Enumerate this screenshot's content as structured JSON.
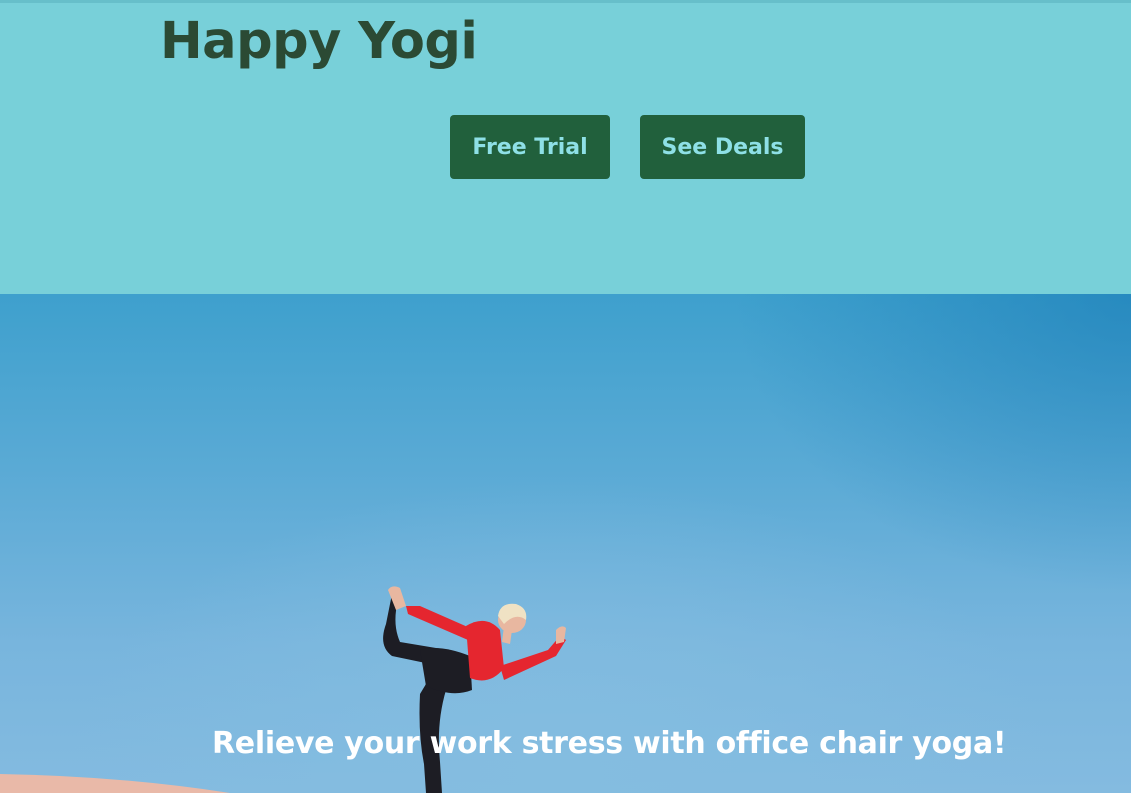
{
  "header": {
    "title": "Happy Yogi",
    "buttons": {
      "free_trial": "Free Trial",
      "see_deals": "See Deals"
    }
  },
  "hero": {
    "image": "yoga-pose-photo",
    "tagline": "Relieve your work stress with office chair yoga!"
  },
  "colors": {
    "header_bg": "#78d0d9",
    "title": "#2b4a34",
    "button_bg": "#21603c",
    "button_text": "#8ee0e6",
    "hero_sky": "#5aaad5",
    "tagline": "#ffffff"
  }
}
